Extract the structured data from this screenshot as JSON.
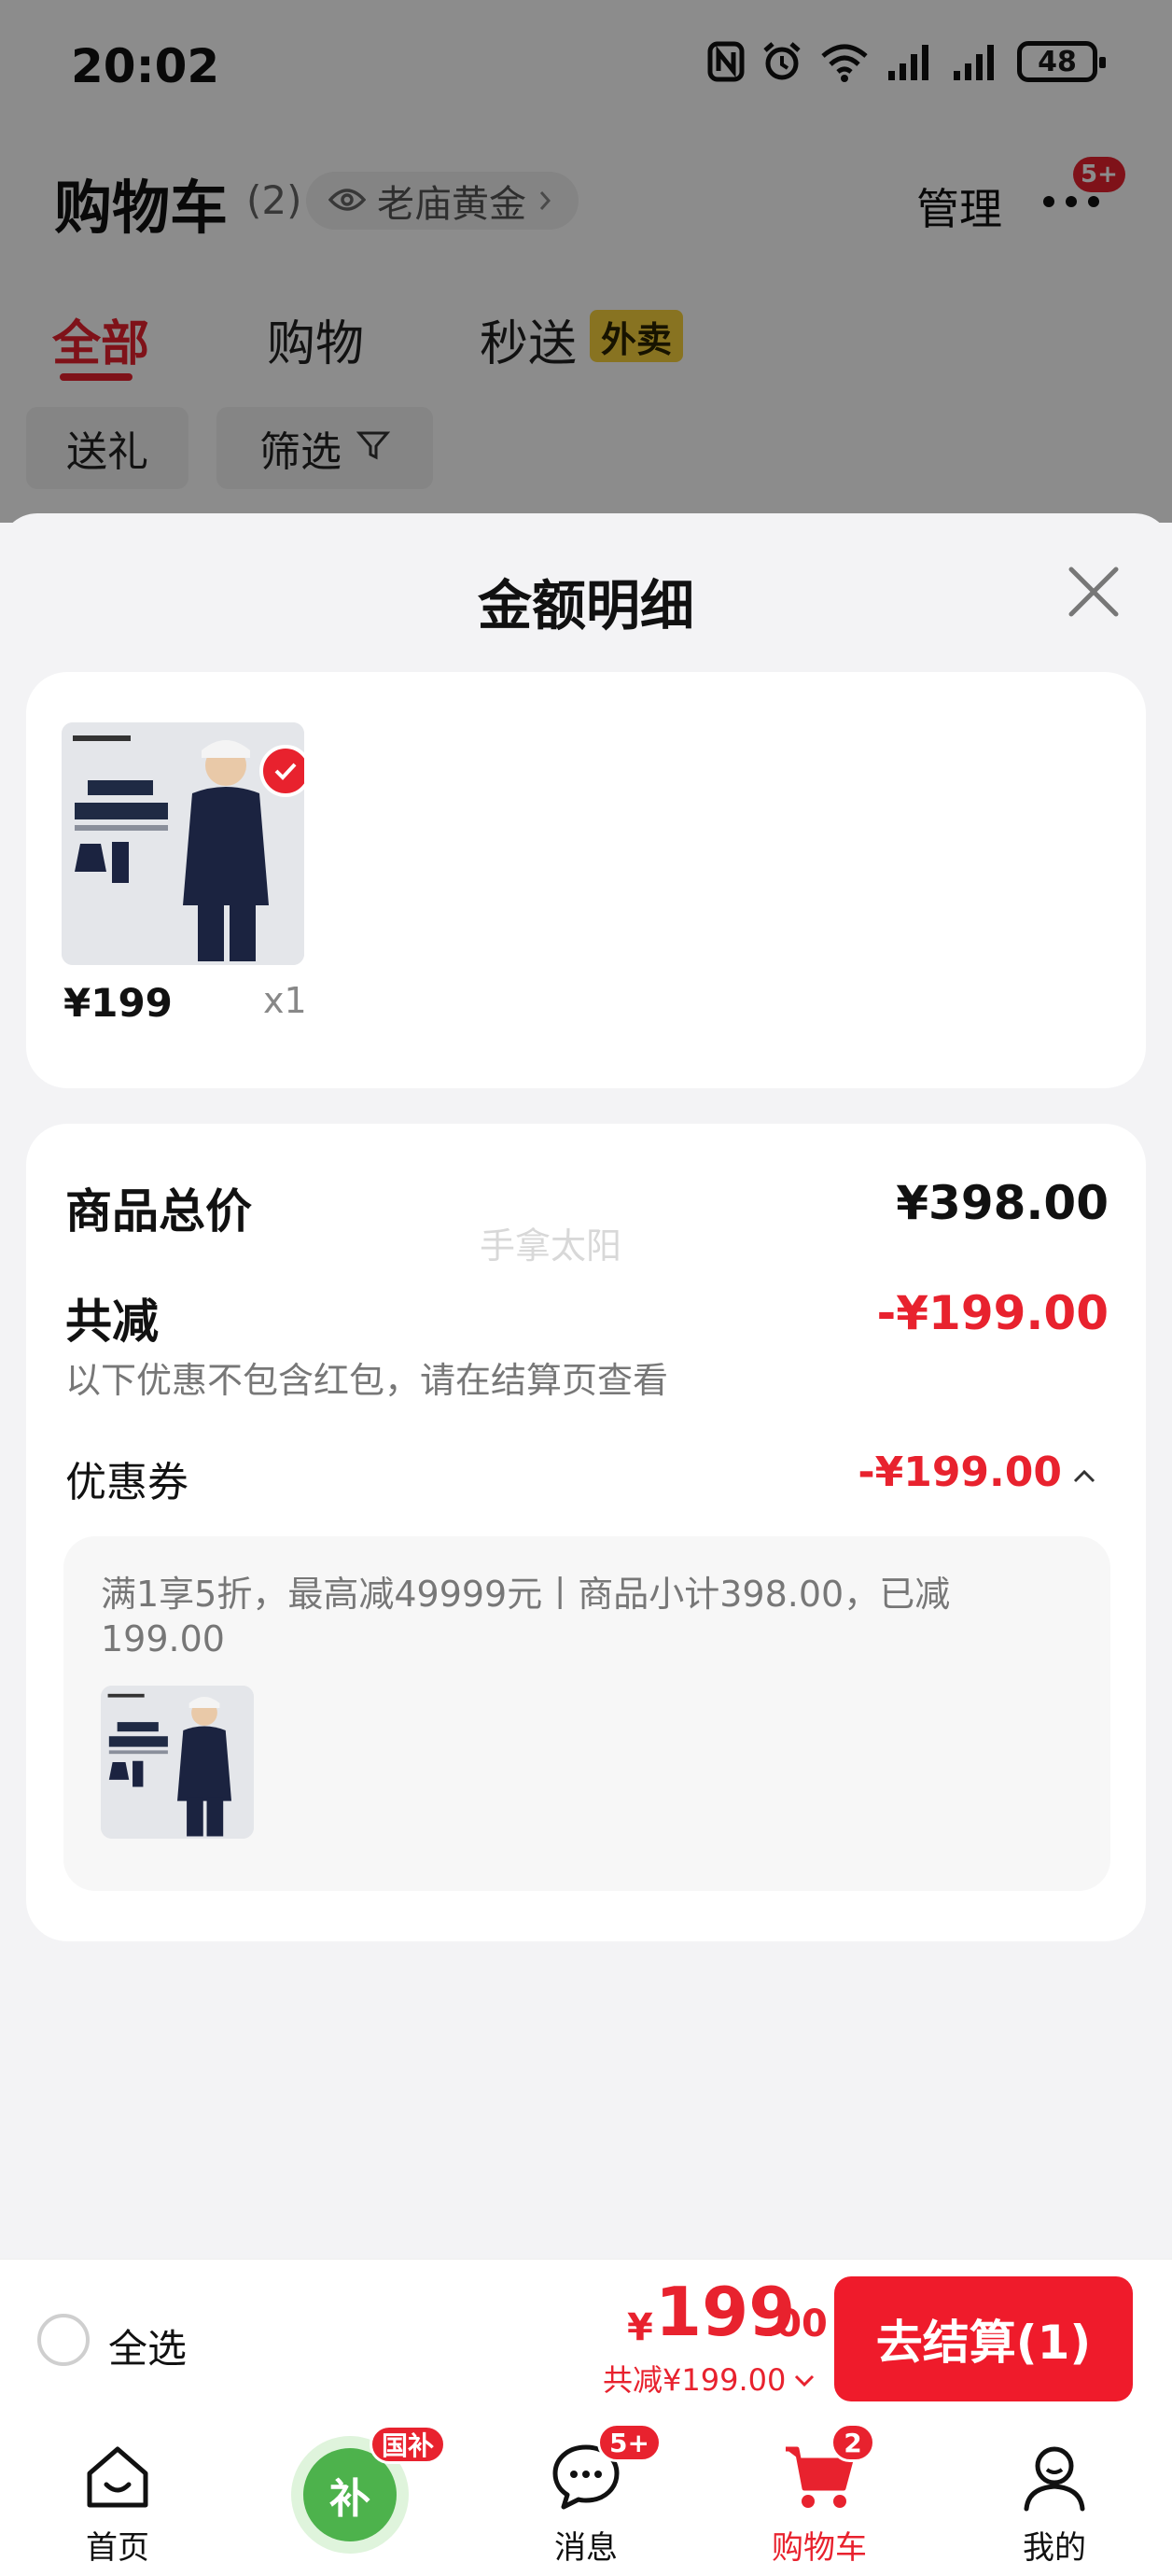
{
  "status_bar": {
    "time": "20:02",
    "battery": "48"
  },
  "header": {
    "title": "购物车",
    "count": "(2)",
    "address": "老庙黄金",
    "manage": "管理",
    "more_badge": "5+"
  },
  "tabs": [
    {
      "label": "全部"
    },
    {
      "label": "购物"
    },
    {
      "label": "秒送"
    }
  ],
  "tab_tag": "外卖",
  "chips": [
    {
      "label": "送礼"
    },
    {
      "label": "筛选"
    }
  ],
  "sheet": {
    "title": "金额明细",
    "item": {
      "price": "¥199",
      "qty": "x1"
    },
    "total_label": "商品总价",
    "total_value": "¥398.00",
    "reduce_label": "共减",
    "reduce_value": "-¥199.00",
    "reduce_note": "以下优惠不包含红包，请在结算页查看",
    "watermark": "手拿太阳",
    "coupon_label": "优惠券",
    "coupon_value": "-¥199.00",
    "coupon_desc": "满1享5折，最高减49999元丨商品小计398.00，已减199.00"
  },
  "checkout": {
    "select_all": "全选",
    "yen": "¥",
    "total_int": "199",
    "total_dec": ".00",
    "saved": "共减¥199.00",
    "button": "去结算(1)"
  },
  "nav": {
    "home": "首页",
    "subsidy_badge": "国补",
    "subsidy_glyph": "补",
    "messages": "消息",
    "messages_badge": "5+",
    "cart": "购物车",
    "cart_badge": "2",
    "mine": "我的"
  },
  "colors": {
    "accent": "#e8222e",
    "tag_yellow": "#f8d23d",
    "subsidy_green": "#4db24c"
  }
}
